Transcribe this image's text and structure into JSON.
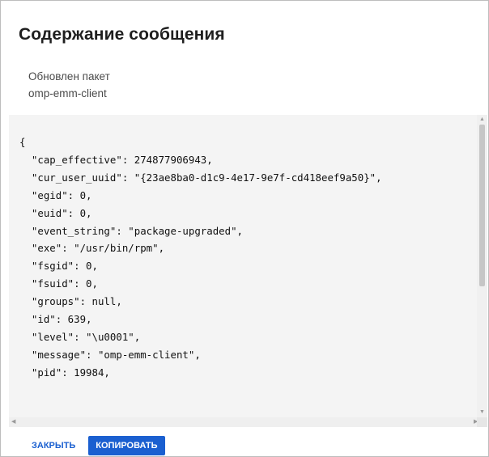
{
  "dialog": {
    "title": "Содержание сообщения",
    "description_line1": "Обновлен пакет",
    "description_line2": "omp-emm-client"
  },
  "message": {
    "lines": [
      "{",
      "  \"cap_effective\": 274877906943,",
      "  \"cur_user_uuid\": \"{23ae8ba0-d1c9-4e17-9e7f-cd418eef9a50}\",",
      "  \"egid\": 0,",
      "  \"euid\": 0,",
      "  \"event_string\": \"package-upgraded\",",
      "  \"exe\": \"/usr/bin/rpm\",",
      "  \"fsgid\": 0,",
      "  \"fsuid\": 0,",
      "  \"groups\": null,",
      "  \"id\": 639,",
      "  \"level\": \"\\u0001\",",
      "  \"message\": \"omp-emm-client\",",
      "  \"pid\": 19984,"
    ]
  },
  "scroll": {
    "up_icon": "triangle-up-icon",
    "down_icon": "triangle-down-icon",
    "left_icon": "triangle-left-icon",
    "right_icon": "triangle-right-icon"
  },
  "footer": {
    "close_label": "ЗАКРЫТЬ",
    "copy_label": "КОПИРОВАТЬ"
  },
  "colors": {
    "accent": "#1a5fd0",
    "code_background": "#f4f4f4"
  }
}
